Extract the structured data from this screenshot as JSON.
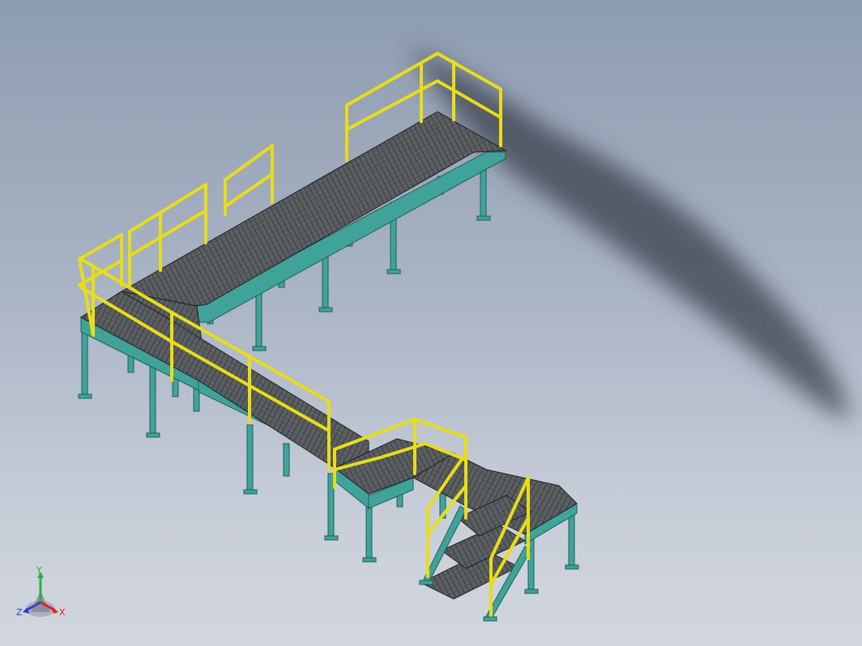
{
  "viewport": {
    "background_top": "#8e9cb0",
    "background_bottom": "#d2d6de"
  },
  "model": {
    "colors": {
      "frame": "#3fa39a",
      "frame_dark": "#1f5e59",
      "grating": "#5a5e60",
      "grating_line": "#2c2f31",
      "handrail": "#f0e61e",
      "handrail_edge": "#6b6200",
      "shadow": "#3a404c"
    }
  },
  "triad": {
    "y_label": "Y",
    "z_label": "Z",
    "x_label": "X",
    "y_color": "#22b14c",
    "z_color": "#2b3fd6",
    "x_color": "#e0201a"
  }
}
